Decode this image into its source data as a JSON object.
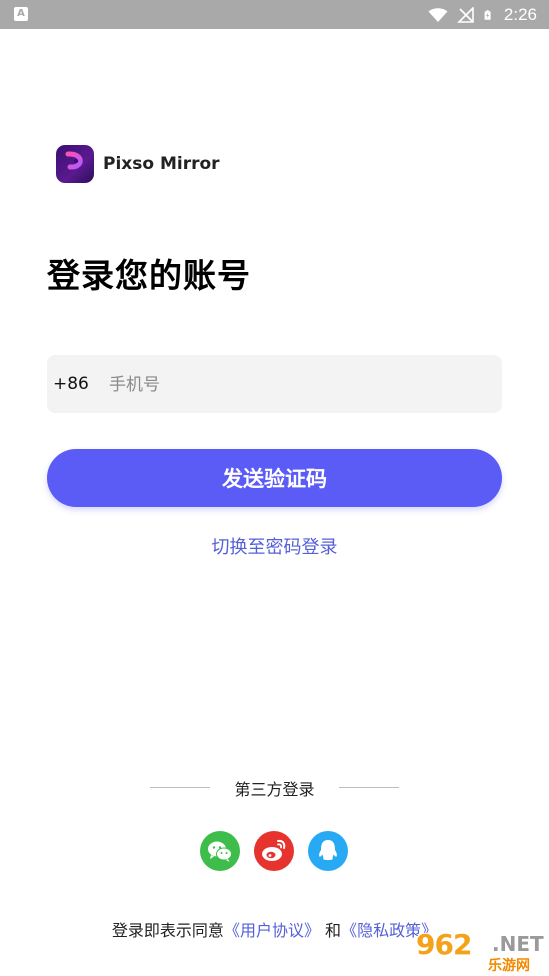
{
  "status_bar": {
    "time": "2:26",
    "left_icon": "A",
    "icons": [
      "wifi-icon",
      "no-signal-icon",
      "battery-charging-icon"
    ]
  },
  "app": {
    "logo_icon": "pixso-logo-icon",
    "name": "Pixso Mirror"
  },
  "page_title": "登录您的账号",
  "phone_field": {
    "country_code": "+86",
    "placeholder": "手机号",
    "value": ""
  },
  "send_button_label": "发送验证码",
  "switch_link_label": "切换至密码登录",
  "third_party": {
    "label": "第三方登录",
    "icons": [
      "wechat-icon",
      "weibo-icon",
      "qq-icon"
    ],
    "colors": {
      "wechat": "#3ebd4b",
      "weibo": "#e6332e",
      "qq": "#27a9f4"
    }
  },
  "agreement": {
    "prefix": "登录即表示同意",
    "user_agreement": "《用户协议》",
    "conjunction": "和",
    "privacy_policy": "《隐私政策》"
  },
  "watermark": {
    "main": "962",
    "net": ".NET",
    "sub": "乐游网"
  },
  "colors": {
    "accent": "#5b5bf6",
    "link": "#5560d8",
    "status_bar": "#a9a9a9",
    "input_bg": "#f3f3f3"
  }
}
